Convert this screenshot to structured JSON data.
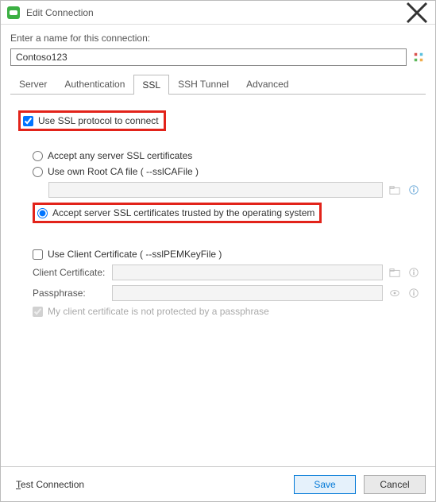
{
  "window": {
    "title": "Edit Connection"
  },
  "prompt": "Enter a name for this connection:",
  "connection_name": "Contoso123",
  "tabs": [
    {
      "label": "Server"
    },
    {
      "label": "Authentication"
    },
    {
      "label": "SSL"
    },
    {
      "label": "SSH Tunnel"
    },
    {
      "label": "Advanced"
    }
  ],
  "active_tab_index": 2,
  "ssl": {
    "use_ssl": {
      "label": "Use SSL protocol to connect",
      "checked": true
    },
    "mode": {
      "accept_any": {
        "label": "Accept any server SSL certificates",
        "selected": false
      },
      "own_ca": {
        "label": "Use own Root CA file ( --sslCAFile )",
        "selected": false
      },
      "os_trusted": {
        "label": "Accept server SSL certificates trusted by the operating system",
        "selected": true
      }
    },
    "client_cert": {
      "use": {
        "label": "Use Client Certificate ( --sslPEMKeyFile )",
        "checked": false
      },
      "cert_label": "Client Certificate:",
      "pass_label": "Passphrase:",
      "no_pass": {
        "label": "My client certificate is not protected by a passphrase",
        "checked": true
      }
    }
  },
  "footer": {
    "test": "Test Connection",
    "save": "Save",
    "cancel": "Cancel"
  }
}
